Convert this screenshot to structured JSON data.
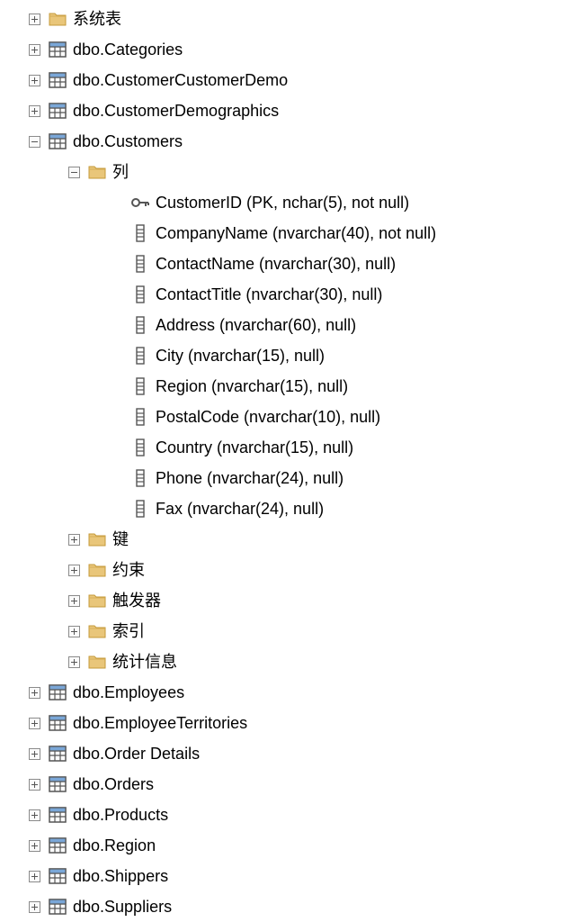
{
  "tree": [
    {
      "indent": 0,
      "expander": "plus",
      "icon": "folder",
      "label": "系统表"
    },
    {
      "indent": 0,
      "expander": "plus",
      "icon": "table",
      "label": "dbo.Categories"
    },
    {
      "indent": 0,
      "expander": "plus",
      "icon": "table",
      "label": "dbo.CustomerCustomerDemo"
    },
    {
      "indent": 0,
      "expander": "plus",
      "icon": "table",
      "label": "dbo.CustomerDemographics"
    },
    {
      "indent": 0,
      "expander": "minus",
      "icon": "table",
      "label": "dbo.Customers"
    },
    {
      "indent": 1,
      "expander": "minus",
      "icon": "folder",
      "label": "列"
    },
    {
      "indent": 2,
      "expander": null,
      "icon": "key",
      "label": "CustomerID (PK, nchar(5), not null)"
    },
    {
      "indent": 2,
      "expander": null,
      "icon": "column",
      "label": "CompanyName (nvarchar(40), not null)"
    },
    {
      "indent": 2,
      "expander": null,
      "icon": "column",
      "label": "ContactName (nvarchar(30), null)"
    },
    {
      "indent": 2,
      "expander": null,
      "icon": "column",
      "label": "ContactTitle (nvarchar(30), null)"
    },
    {
      "indent": 2,
      "expander": null,
      "icon": "column",
      "label": "Address (nvarchar(60), null)"
    },
    {
      "indent": 2,
      "expander": null,
      "icon": "column",
      "label": "City (nvarchar(15), null)"
    },
    {
      "indent": 2,
      "expander": null,
      "icon": "column",
      "label": "Region (nvarchar(15), null)"
    },
    {
      "indent": 2,
      "expander": null,
      "icon": "column",
      "label": "PostalCode (nvarchar(10), null)"
    },
    {
      "indent": 2,
      "expander": null,
      "icon": "column",
      "label": "Country (nvarchar(15), null)"
    },
    {
      "indent": 2,
      "expander": null,
      "icon": "column",
      "label": "Phone (nvarchar(24), null)"
    },
    {
      "indent": 2,
      "expander": null,
      "icon": "column",
      "label": "Fax (nvarchar(24), null)"
    },
    {
      "indent": 1,
      "expander": "plus",
      "icon": "folder",
      "label": "键"
    },
    {
      "indent": 1,
      "expander": "plus",
      "icon": "folder",
      "label": "约束"
    },
    {
      "indent": 1,
      "expander": "plus",
      "icon": "folder",
      "label": "触发器"
    },
    {
      "indent": 1,
      "expander": "plus",
      "icon": "folder",
      "label": "索引"
    },
    {
      "indent": 1,
      "expander": "plus",
      "icon": "folder",
      "label": "统计信息"
    },
    {
      "indent": 0,
      "expander": "plus",
      "icon": "table",
      "label": "dbo.Employees"
    },
    {
      "indent": 0,
      "expander": "plus",
      "icon": "table",
      "label": "dbo.EmployeeTerritories"
    },
    {
      "indent": 0,
      "expander": "plus",
      "icon": "table",
      "label": "dbo.Order Details"
    },
    {
      "indent": 0,
      "expander": "plus",
      "icon": "table",
      "label": "dbo.Orders"
    },
    {
      "indent": 0,
      "expander": "plus",
      "icon": "table",
      "label": "dbo.Products"
    },
    {
      "indent": 0,
      "expander": "plus",
      "icon": "table",
      "label": "dbo.Region"
    },
    {
      "indent": 0,
      "expander": "plus",
      "icon": "table",
      "label": "dbo.Shippers"
    },
    {
      "indent": 0,
      "expander": "plus",
      "icon": "table",
      "label": "dbo.Suppliers"
    }
  ]
}
